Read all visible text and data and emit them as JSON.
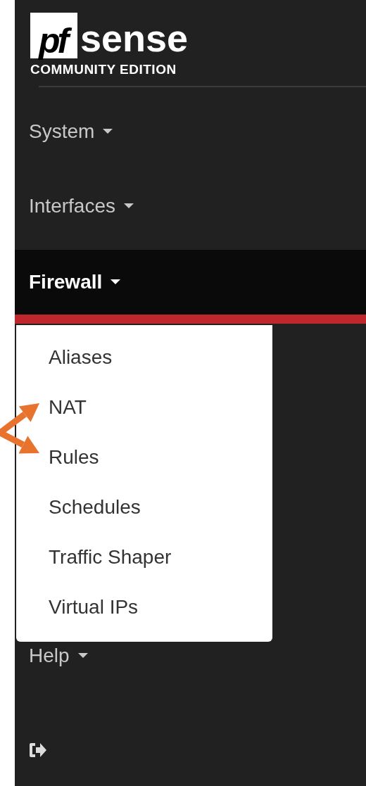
{
  "logo": {
    "mark": "pf",
    "name": "sense",
    "edition": "COMMUNITY EDITION"
  },
  "nav": [
    {
      "label": "System",
      "selected": false
    },
    {
      "label": "Interfaces",
      "selected": false
    },
    {
      "label": "Firewall",
      "selected": true
    }
  ],
  "firewall_menu": [
    {
      "label": "Aliases",
      "marked": false
    },
    {
      "label": "NAT",
      "marked": true
    },
    {
      "label": "Rules",
      "marked": true
    },
    {
      "label": "Schedules",
      "marked": false
    },
    {
      "label": "Traffic Shaper",
      "marked": false
    },
    {
      "label": "Virtual IPs",
      "marked": false
    }
  ],
  "nav_after": [
    {
      "label": "Help",
      "selected": false
    }
  ]
}
